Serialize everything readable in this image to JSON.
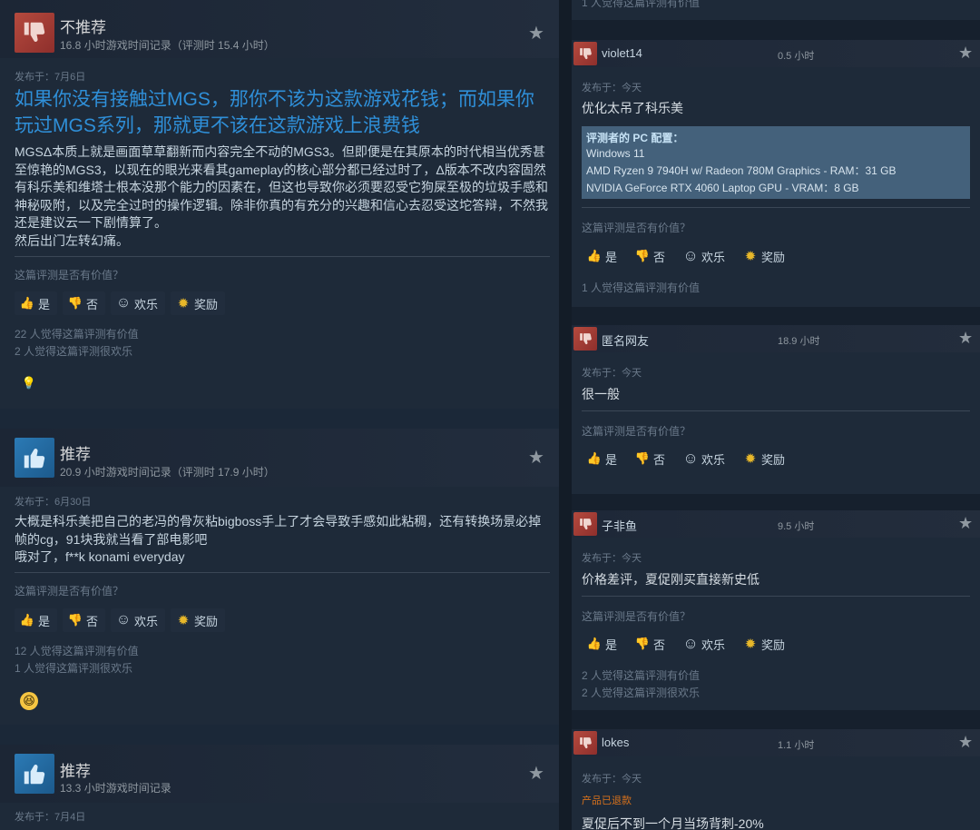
{
  "left_reviews": [
    {
      "verdict": "不推荐",
      "hours": "16.8 小时游戏时间记录（评测时 15.4 小时）",
      "posted": "发布于：7月6日",
      "title": "如果你没有接触过MGS，那你不该为这款游戏花钱；而如果你玩过MGS系列，那就更不该在这款游戏上浪费钱",
      "body": "MGSΔ本质上就是画面草草翻新而内容完全不动的MGS3。但即便是在其原本的时代相当优秀甚至惊艳的MGS3，以现在的眼光来看其gameplay的核心部分都已经过时了，Δ版本不改内容固然有科乐美和维塔士根本没那个能力的因素在，但这也导致你必须要忍受它狗屎至极的垃圾手感和神秘吸附，以及完全过时的操作逻辑。除非你真的有充分的兴趣和信心去忍受这坨答辩，不然我还是建议云一下剧情算了。\n然后出门左转幻痛。",
      "question": "这篇评测是否有价值？",
      "stats": [
        "22 人觉得这篇评测有价值",
        "2 人觉得这篇评测很欢乐"
      ]
    },
    {
      "verdict": "推荐",
      "hours": "20.9 小时游戏时间记录（评测时 17.9 小时）",
      "posted": "发布于：6月30日",
      "body": "大概是科乐美把自己的老冯的骨灰粘bigboss手上了才会导致手感如此粘稠，还有转换场景必掉帧的cg，91块我就当看了部电影吧\n哦对了，f**k konami everyday",
      "question": "这篇评测是否有价值？",
      "stats": [
        "12 人觉得这篇评测有价值",
        "1 人觉得这篇评测很欢乐"
      ]
    },
    {
      "verdict": "推荐",
      "hours": "13.3 小时游戏时间记录",
      "posted": "发布于：7月4日"
    }
  ],
  "buttons": {
    "yes": "是",
    "no": "否",
    "funny": "欢乐",
    "award": "奖励"
  },
  "right_top_stat": "1 人觉得这篇评测有价值",
  "right_reviews": [
    {
      "name": "violet14",
      "hours": "0.5 小时",
      "posted": "发布于：今天",
      "body": "优化太吊了科乐美",
      "pc_label": "评测者的 PC 配置：",
      "pc_lines": [
        "Windows 11",
        "AMD Ryzen 9 7940H w/ Radeon 780M Graphics - RAM：31 GB",
        "NVIDIA GeForce RTX 4060 Laptop GPU - VRAM：8 GB"
      ],
      "question": "这篇评测是否有价值？",
      "stats": [
        "1 人觉得这篇评测有价值"
      ]
    },
    {
      "name": "匿名网友",
      "hours": "18.9 小时",
      "posted": "发布于：今天",
      "body": "很一般",
      "question": "这篇评测是否有价值？"
    },
    {
      "name": "子非鱼",
      "hours": "9.5 小时",
      "posted": "发布于：今天",
      "body": "价格差评，夏促刚买直接新史低",
      "question": "这篇评测是否有价值？",
      "stats": [
        "2 人觉得这篇评测有价值",
        "2 人觉得这篇评测很欢乐"
      ]
    },
    {
      "name": "lokes",
      "hours": "1.1 小时",
      "posted": "发布于：今天",
      "refunded": "产品已退款",
      "body": "夏促后不到一个月当场背刺-20%"
    }
  ],
  "colors": {
    "accent_blue": "#2f8fd8",
    "thumb_down_red": "#b54a3e",
    "thumb_up_blue": "#2b7ab5",
    "refund_orange": "#d8721c",
    "award_gold": "#e8b82a"
  }
}
